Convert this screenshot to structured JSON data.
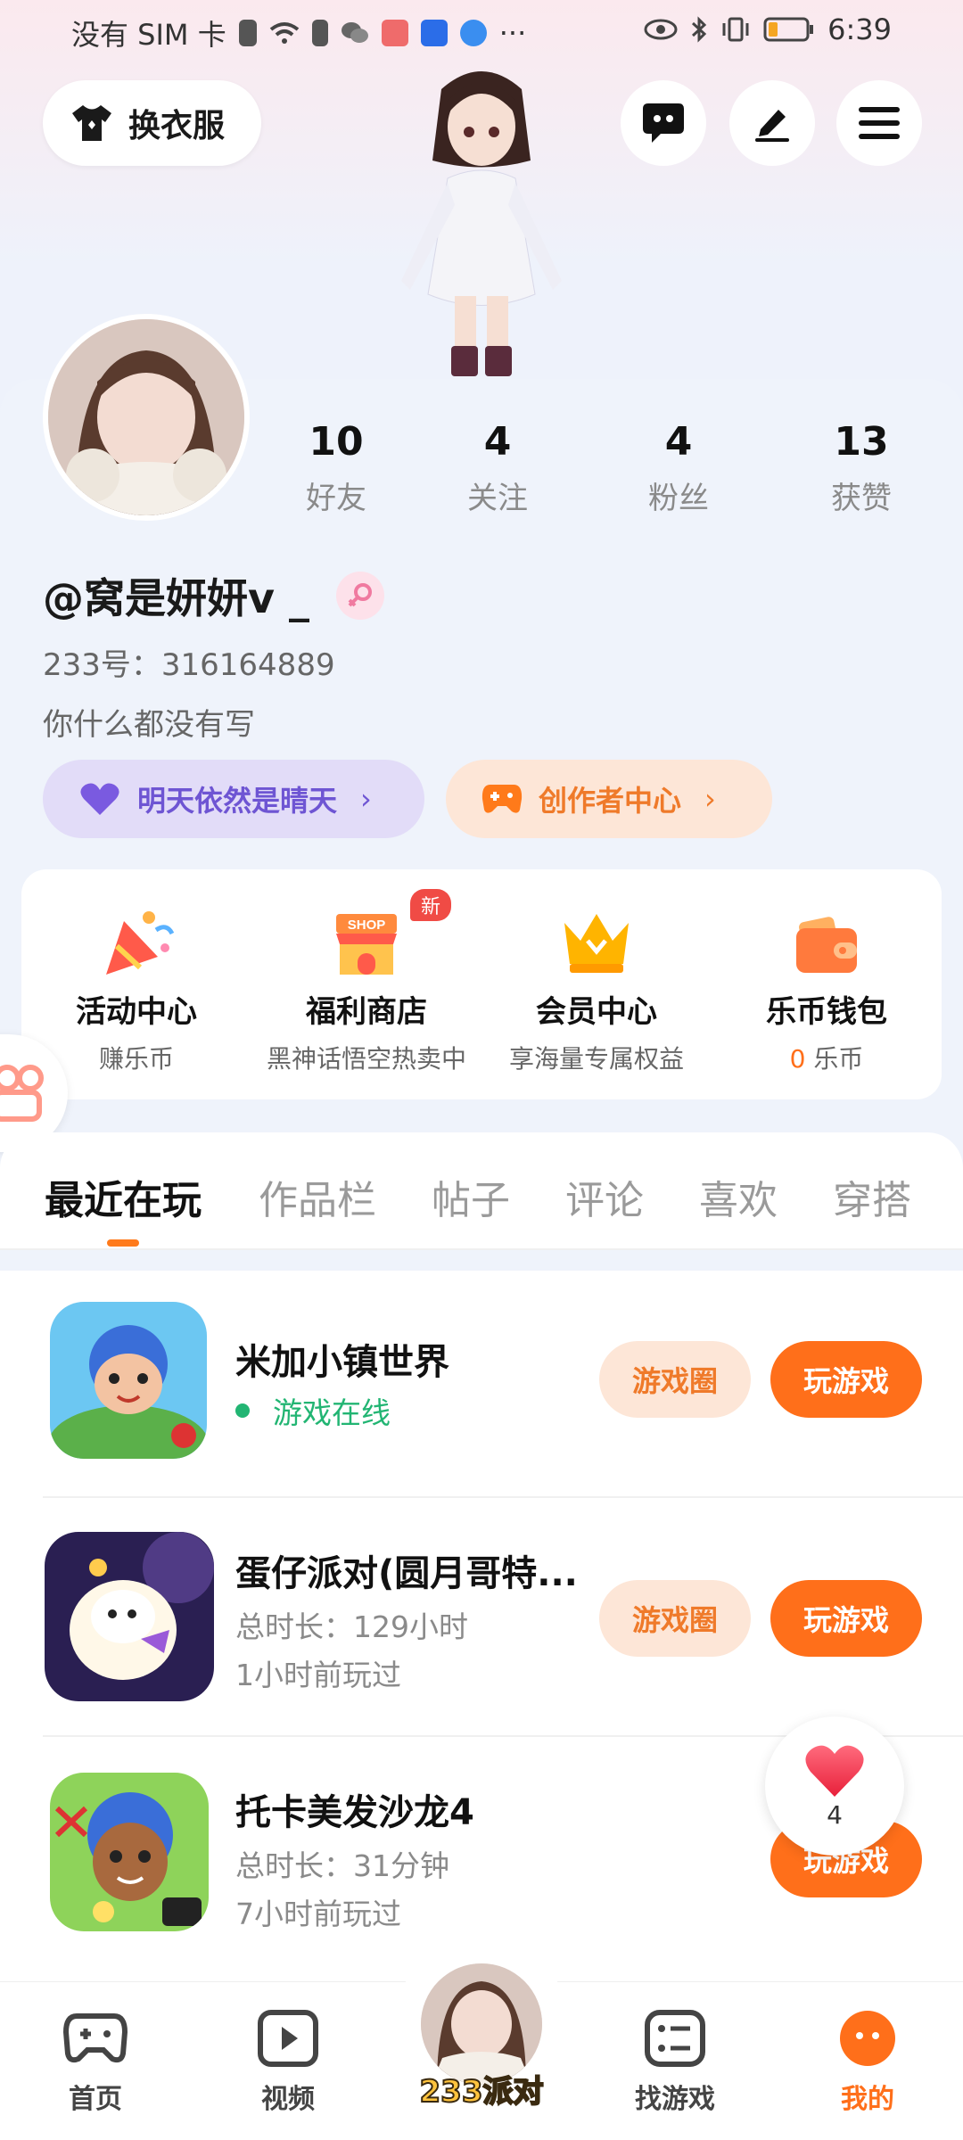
{
  "status_bar": {
    "carrier": "没有 SIM 卡",
    "time": "6:39",
    "dots": "···"
  },
  "header": {
    "dress_button": "换衣服"
  },
  "profile": {
    "stats": [
      {
        "num": "10",
        "label": "好友"
      },
      {
        "num": "4",
        "label": "关注"
      },
      {
        "num": "4",
        "label": "粉丝"
      },
      {
        "num": "13",
        "label": "获赞"
      }
    ],
    "username": "@窝是妍妍v _",
    "uid": "233号：316164889",
    "bio": "你什么都没有写",
    "pill_left": "明天依然是晴天",
    "pill_right": "创作者中心"
  },
  "tiles": [
    {
      "title": "活动中心",
      "sub": "赚乐币"
    },
    {
      "title": "福利商店",
      "sub": "黑神话悟空热卖中",
      "badge": "新",
      "shop_label": "SHOP"
    },
    {
      "title": "会员中心",
      "sub": "享海量专属权益"
    },
    {
      "title": "乐币钱包",
      "sub_num": "0",
      "sub": " 乐币"
    }
  ],
  "tabs": [
    "最近在玩",
    "作品栏",
    "帖子",
    "评论",
    "喜欢",
    "穿搭"
  ],
  "games": [
    {
      "title": "米加小镇世界",
      "status": "游戏在线",
      "circle_btn": "游戏圈",
      "play_btn": "玩游戏"
    },
    {
      "title": "蛋仔派对(圆月哥特...",
      "line1": "总时长：129小时",
      "line2": "1小时前玩过",
      "circle_btn": "游戏圈",
      "play_btn": "玩游戏"
    },
    {
      "title": "托卡美发沙龙4",
      "line1": "总时长：31分钟",
      "line2": "7小时前玩过",
      "play_btn": "玩游戏"
    }
  ],
  "like_float": {
    "count": "4"
  },
  "nav": [
    {
      "label": "首页"
    },
    {
      "label": "视频"
    },
    {
      "label": "233派对"
    },
    {
      "label": "找游戏"
    },
    {
      "label": "我的"
    }
  ],
  "colors": {
    "accent": "#ff6f1a",
    "purple": "#6e55d3",
    "online": "#22b573"
  }
}
